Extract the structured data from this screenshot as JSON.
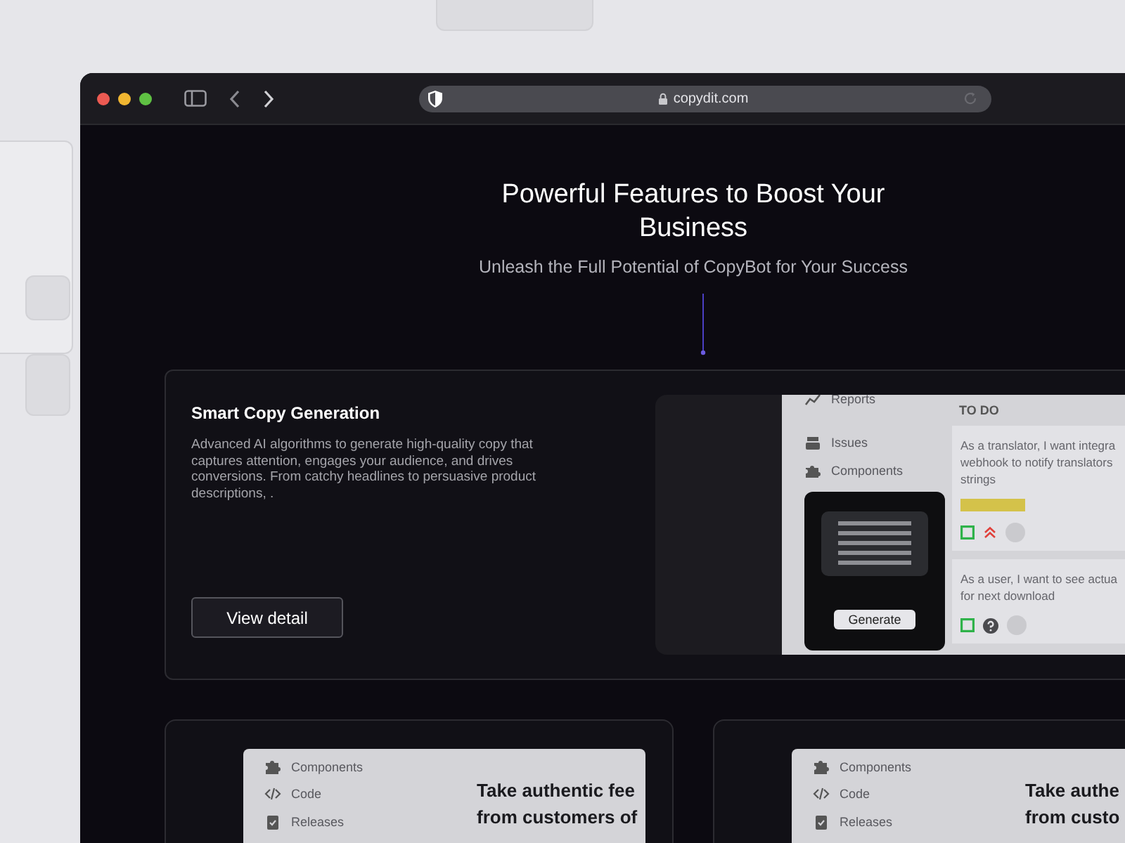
{
  "browser": {
    "url": "copydit.com"
  },
  "hero": {
    "title": "Powerful Features to Boost Your Business",
    "subtitle": "Unleash the Full Potential of CopyBot for Your Success"
  },
  "feature": {
    "title": "Smart Copy Generation",
    "description": "Advanced AI algorithms to generate high-quality copy that captures attention, engages your audience, and drives conversions. From catchy headlines to persuasive product descriptions, .",
    "button": "View detail",
    "mockup": {
      "nav": [
        {
          "kind": "chart",
          "label": "Reports"
        },
        {
          "kind": "stack",
          "label": "Issues"
        },
        {
          "kind": "puzzle",
          "label": "Components"
        }
      ],
      "generate_button": "Generate",
      "column_title": "TO DO",
      "tasks": [
        {
          "lines": [
            "As a translator, I want integra",
            "webhook to notify translators",
            "strings"
          ],
          "tag": {
            "color": "#d4c24a"
          },
          "icons": [
            {
              "kind": "story"
            },
            {
              "kind": "priority-high"
            },
            {
              "kind": "avatar"
            }
          ]
        },
        {
          "lines": [
            "As a user, I want to see actua",
            "for next download"
          ],
          "icons": [
            {
              "kind": "story"
            },
            {
              "kind": "help"
            },
            {
              "kind": "avatar"
            }
          ]
        }
      ]
    }
  },
  "cards": [
    {
      "nav": [
        {
          "kind": "puzzle",
          "label": "Components"
        },
        {
          "kind": "code",
          "label": "Code"
        },
        {
          "kind": "clipboard",
          "label": "Releases"
        }
      ],
      "headline": [
        "Take authentic fee",
        "from customers of"
      ]
    },
    {
      "nav": [
        {
          "kind": "puzzle",
          "label": "Components"
        },
        {
          "kind": "code",
          "label": "Code"
        },
        {
          "kind": "clipboard",
          "label": "Releases"
        }
      ],
      "headline": [
        "Take authe",
        "from custo"
      ]
    }
  ]
}
